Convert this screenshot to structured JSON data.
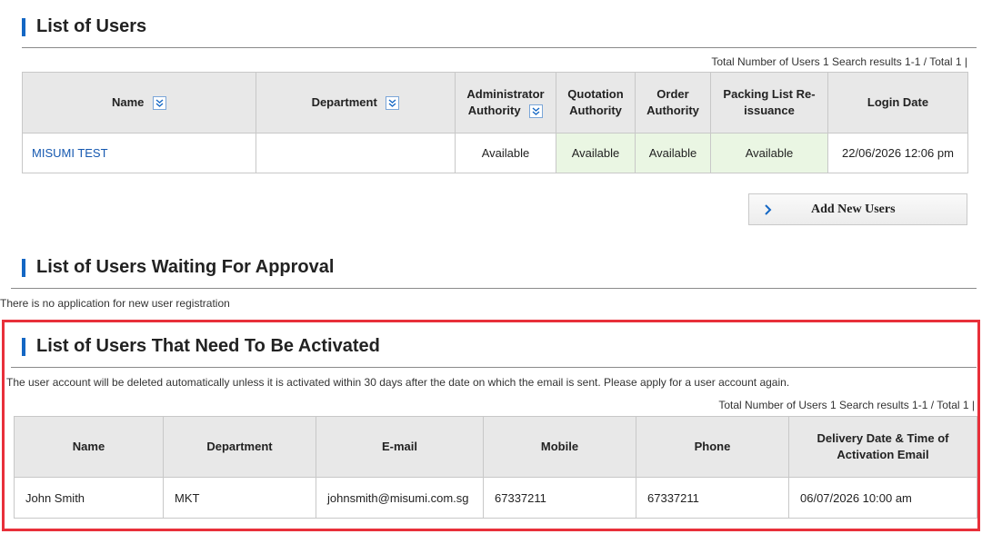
{
  "users_section": {
    "title": "List of Users",
    "summary": "Total Number of Users 1  Search results 1-1 / Total 1 |",
    "columns": [
      "Name",
      "Department",
      "Administrator Authority",
      "Quotation Authority",
      "Order Authority",
      "Packing List Re-issuance",
      "Login Date"
    ],
    "rows": [
      {
        "name": "MISUMI TEST",
        "department": "",
        "admin_authority": "Available",
        "quotation_authority": "Available",
        "order_authority": "Available",
        "packing_reissuance": "Available",
        "login_date": "22/06/2026 12:06 pm"
      }
    ],
    "add_button_label": "Add New Users"
  },
  "approval_section": {
    "title": "List of Users Waiting For Approval",
    "message": "There is no application for new user registration"
  },
  "activation_section": {
    "title": "List of Users That Need To Be Activated",
    "notice": "The user account will be deleted automatically unless it is activated within 30 days after the date on which the email is sent. Please apply for a user account again.",
    "summary": "Total Number of Users 1  Search results 1-1 / Total 1 |",
    "columns": [
      "Name",
      "Department",
      "E-mail",
      "Mobile",
      "Phone",
      "Delivery Date & Time of Activation Email"
    ],
    "rows": [
      {
        "name": "John Smith",
        "department": "MKT",
        "email": "johnsmith@misumi.com.sg",
        "mobile": "67337211",
        "phone": "67337211",
        "delivery": "06/07/2026 10:00 am"
      }
    ]
  },
  "colors": {
    "accent": "#1467c4",
    "available_bg": "#eaf6e3",
    "highlight": "#e8303a",
    "link": "#1558b0"
  }
}
